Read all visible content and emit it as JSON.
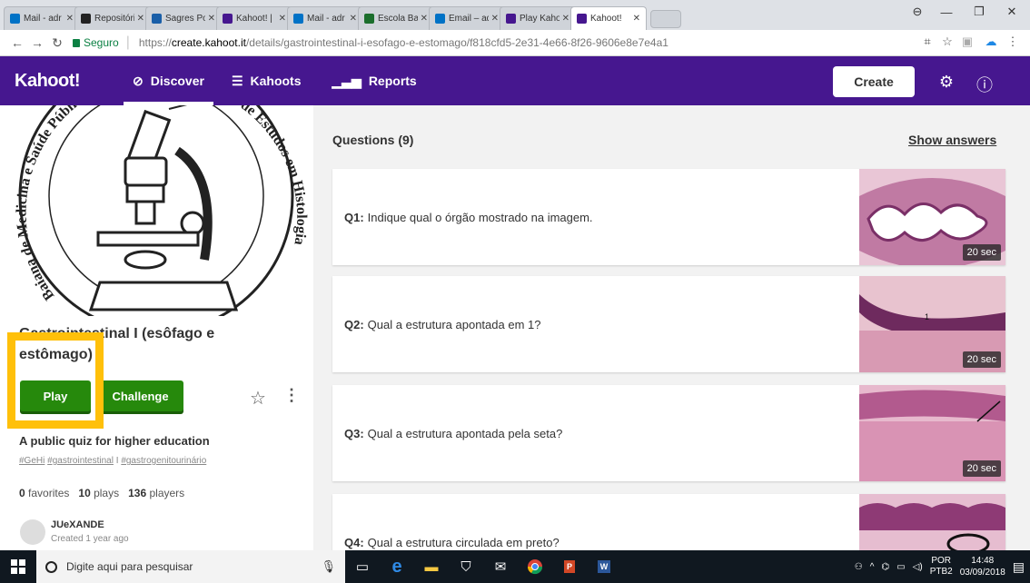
{
  "browser": {
    "tabs": [
      {
        "label": "Mail - adr",
        "color": "#0072c6"
      },
      {
        "label": "Repositóri",
        "color": "#222222"
      },
      {
        "label": "Sagres Po",
        "color": "#1a5fa8"
      },
      {
        "label": "Kahoot! |",
        "color": "#46178f"
      },
      {
        "label": "Mail - adr",
        "color": "#0072c6"
      },
      {
        "label": "Escola Bal",
        "color": "#1b6e2c"
      },
      {
        "label": "Email – ad",
        "color": "#0072c6"
      },
      {
        "label": "Play Kaho",
        "color": "#46178f"
      },
      {
        "label": "Kahoot!",
        "color": "#46178f"
      }
    ],
    "secure_label": "Seguro",
    "url_scheme": "https://",
    "url_host": "create.kahoot.it",
    "url_path": "/details/gastrointestinal-i-esofago-e-estomago/f818cfd5-2e31-4e66-8f26-9606e8e7e4a1"
  },
  "nav": {
    "logo": "Kahoot!",
    "discover": "Discover",
    "kahoots": "Kahoots",
    "reports": "Reports",
    "create": "Create"
  },
  "quiz": {
    "title": "Gastrointestinal I (esôfago e estômago)",
    "play": "Play",
    "challenge": "Challenge",
    "description": "A public quiz for higher education",
    "tags": [
      "#GeHi",
      "#gastrointestinal",
      "#gastrogenitourinário"
    ],
    "favorites_count": "0",
    "favorites_label": "favorites",
    "plays_count": "10",
    "plays_label": "plays",
    "players_count": "136",
    "players_label": "players",
    "author": "JUeXANDE",
    "created": "Created 1 year ago",
    "cover_text_arc_left": "Baiana de Medicina e Saúde Pública",
    "cover_text_arc_right": "Grupo de Estudos em Histologia"
  },
  "questions": {
    "header": "Questions (9)",
    "show_answers": "Show answers",
    "items": [
      {
        "num": "Q1:",
        "text": "Indique qual o órgão mostrado na imagem.",
        "time": "20 sec"
      },
      {
        "num": "Q2:",
        "text": "Qual a estrutura apontada em 1?",
        "time": "20 sec"
      },
      {
        "num": "Q3:",
        "text": "Qual a estrutura apontada pela seta?",
        "time": "20 sec"
      },
      {
        "num": "Q4:",
        "text": "Qual a estrutura circulada em preto?",
        "time": ""
      }
    ]
  },
  "taskbar": {
    "search_placeholder": "Digite aqui para pesquisar",
    "lang": "POR",
    "layout": "PTB2",
    "time": "14:48",
    "date": "03/09/2018"
  },
  "colors": {
    "kahoot_purple": "#46178f",
    "play_green": "#26890c",
    "highlight_yellow": "#ffc00a"
  }
}
